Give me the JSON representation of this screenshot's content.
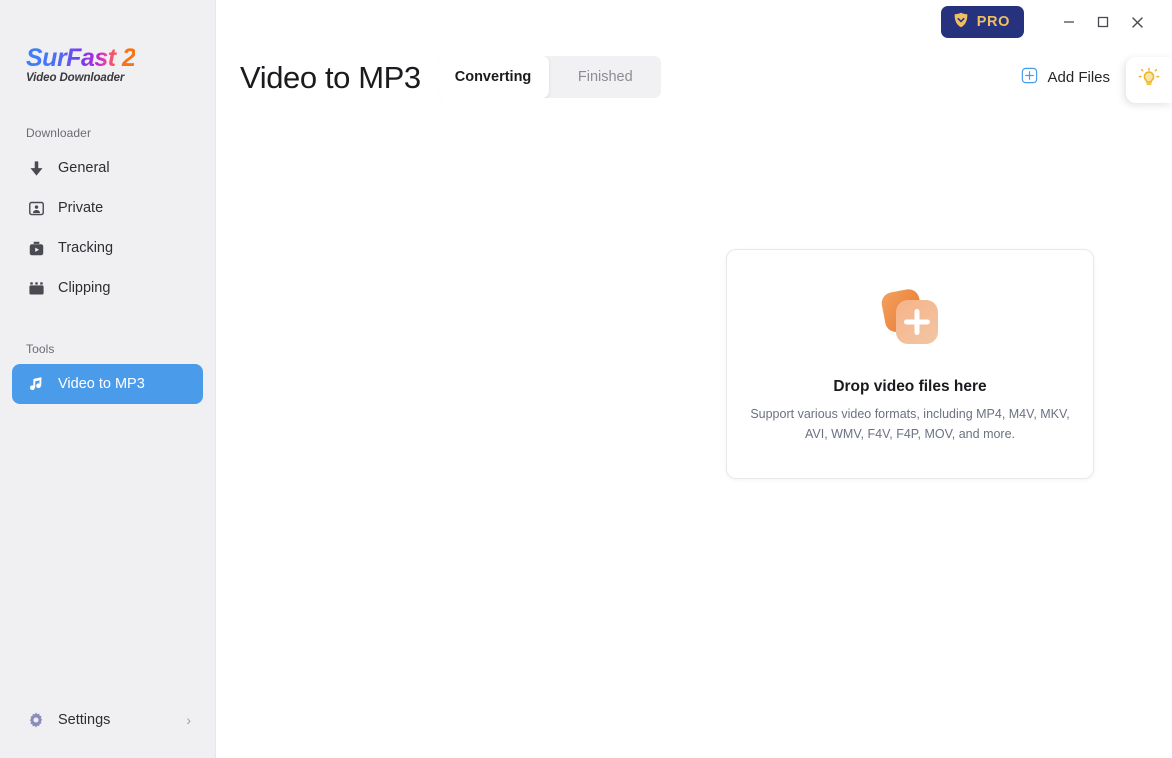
{
  "brand": {
    "name": "SurFast 2",
    "subtitle": "Video Downloader"
  },
  "sidebar": {
    "downloader_label": "Downloader",
    "tools_label": "Tools",
    "downloader_items": [
      {
        "label": "General",
        "icon": "download-arrow-icon"
      },
      {
        "label": "Private",
        "icon": "private-person-icon"
      },
      {
        "label": "Tracking",
        "icon": "tracking-camera-icon"
      },
      {
        "label": "Clipping",
        "icon": "clipping-film-icon"
      }
    ],
    "tools_items": [
      {
        "label": "Video to MP3",
        "icon": "music-note-icon",
        "active": true
      }
    ],
    "settings_label": "Settings",
    "settings_chevron": "›"
  },
  "titlebar": {
    "pro_label": "PRO",
    "minimize": "minimize-icon",
    "maximize": "maximize-icon",
    "close": "close-icon"
  },
  "header": {
    "title": "Video to MP3",
    "tabs": [
      {
        "label": "Converting",
        "active": true
      },
      {
        "label": "Finished",
        "active": false
      }
    ],
    "add_files_label": "Add Files"
  },
  "dropzone": {
    "title": "Drop video files here",
    "description": "Support various video formats, including MP4, M4V, MKV, AVI, WMV, F4V, F4P, MOV, and more."
  },
  "tips": {
    "icon": "lightbulb-icon"
  },
  "colors": {
    "accent_blue": "#4a9ceb",
    "pro_navy": "#26327e",
    "pro_gold": "#f0c060",
    "sidebar_bg": "#f0eff2",
    "dropzone_orange": "#f08a4b"
  }
}
